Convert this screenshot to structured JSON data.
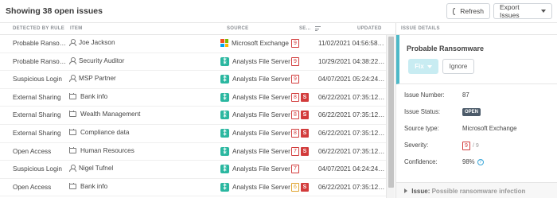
{
  "header": {
    "title": "Showing 38 open issues",
    "refresh_label": "Refresh",
    "export_label": "Export Issues"
  },
  "columns": {
    "rule": "DETECTED BY RULE",
    "item": "ITEM",
    "source": "SOURCE",
    "severity": "SE...",
    "updated": "UPDATED"
  },
  "rows": [
    {
      "rule": "Probable Ransomware",
      "item": "Joe Jackson",
      "item_type": "user-icon",
      "source": "Microsoft Exchange",
      "source_type": "microsoft-icon",
      "sev": "9",
      "sev2": "",
      "updated": "11/02/2021 04:56:58 AM"
    },
    {
      "rule": "Probable Ransomware",
      "item": "Security Auditor",
      "item_type": "user-icon",
      "source": "Analysts File Server",
      "source_type": "file-server-icon",
      "sev": "9",
      "sev2": "",
      "updated": "10/29/2021 04:38:22 AM"
    },
    {
      "rule": "Suspicious Login",
      "item": "MSP Partner",
      "item_type": "user-icon",
      "source": "Analysts File Server",
      "source_type": "file-server-icon",
      "sev": "9",
      "sev2": "",
      "updated": "04/07/2021 05:24:24 AM"
    },
    {
      "rule": "External Sharing",
      "item": "Bank info",
      "item_type": "folder-icon",
      "source": "Analysts File Server",
      "source_type": "file-server-icon",
      "sev": "8",
      "sev2": "S",
      "updated": "06/22/2021 07:35:12 AM"
    },
    {
      "rule": "External Sharing",
      "item": "Wealth Management",
      "item_type": "folder-icon",
      "source": "Analysts File Server",
      "source_type": "file-server-icon",
      "sev": "8",
      "sev2": "S",
      "updated": "06/22/2021 07:35:12 AM"
    },
    {
      "rule": "External Sharing",
      "item": "Compliance data",
      "item_type": "folder-icon",
      "source": "Analysts File Server",
      "source_type": "file-server-icon",
      "sev": "8",
      "sev2": "S",
      "updated": "06/22/2021 07:35:12 AM"
    },
    {
      "rule": "Open Access",
      "item": "Human Resources",
      "item_type": "folder-icon",
      "source": "Analysts File Server",
      "source_type": "file-server-icon",
      "sev": "7",
      "sev2": "S",
      "updated": "06/22/2021 07:35:12 AM"
    },
    {
      "rule": "Suspicious Login",
      "item": "Nigel Tufnel",
      "item_type": "user-icon",
      "source": "Analysts File Server",
      "source_type": "file-server-icon",
      "sev": "7",
      "sev2": "",
      "updated": "04/07/2021 04:24:24 AM"
    },
    {
      "rule": "Open Access",
      "item": "Bank info",
      "item_type": "folder-icon",
      "source": "Analysts File Server",
      "source_type": "file-server-icon",
      "sev": "6",
      "sev2": "S",
      "updated": "06/22/2021 07:35:12 AM"
    }
  ],
  "details": {
    "header": "ISSUE DETAILS",
    "title": "Probable Ransomware",
    "fix_label": "Fix",
    "ignore_label": "Ignore",
    "fields": [
      {
        "key": "Issue Number:",
        "value": "87"
      },
      {
        "key": "Issue Status:",
        "value": "OPEN"
      },
      {
        "key": "Source type:",
        "value": "Microsoft Exchange"
      },
      {
        "key": "Severity:",
        "value": "9",
        "of": "/ 9"
      },
      {
        "key": "Confidence:",
        "value": "98%"
      }
    ],
    "issue_label": "Issue:",
    "issue_value": "Possible ransomware infection"
  },
  "colors": {
    "accent": "#4db9c8",
    "severity_high": "#d23b3b",
    "severity_mid": "#e0a32c",
    "file_server": "#2ab7a0"
  }
}
